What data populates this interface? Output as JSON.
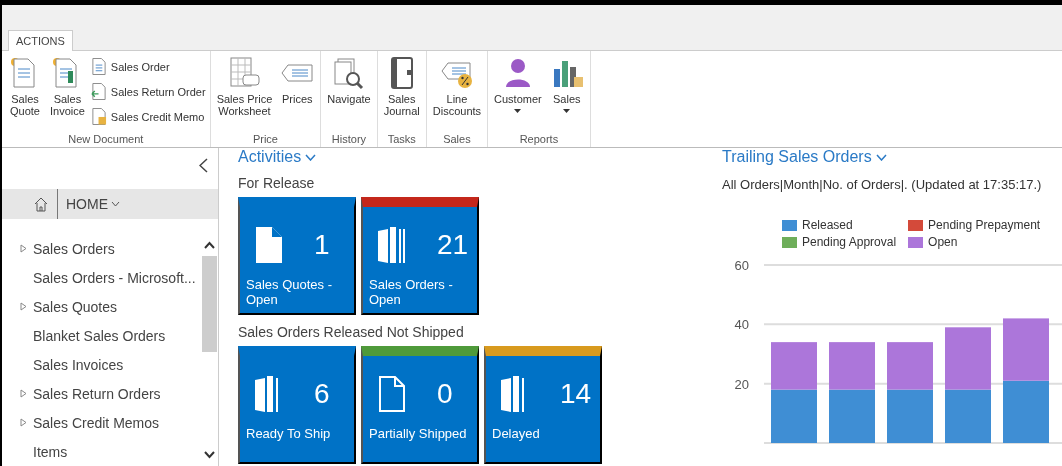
{
  "ribbon": {
    "tabs": [
      {
        "label": "ACTIONS",
        "selected": true
      }
    ],
    "groups": [
      {
        "label": "New Document",
        "items": [
          {
            "kind": "large",
            "label": "Sales\nQuote"
          },
          {
            "kind": "large",
            "label": "Sales\nInvoice"
          },
          {
            "kind": "small",
            "label": "Sales Order"
          },
          {
            "kind": "small",
            "label": "Sales Return Order"
          },
          {
            "kind": "small",
            "label": "Sales Credit Memo"
          }
        ]
      },
      {
        "label": "Price",
        "items": [
          {
            "kind": "large",
            "label": "Sales Price\nWorksheet"
          },
          {
            "kind": "large",
            "label": "Prices"
          }
        ]
      },
      {
        "label": "History",
        "items": [
          {
            "kind": "large",
            "label": "Navigate"
          }
        ]
      },
      {
        "label": "Tasks",
        "items": [
          {
            "kind": "large",
            "label": "Sales\nJournal"
          }
        ]
      },
      {
        "label": "Sales",
        "items": [
          {
            "kind": "large",
            "label": "Line\nDiscounts"
          }
        ]
      },
      {
        "label": "Reports",
        "items": [
          {
            "kind": "menu",
            "label": "Customer"
          },
          {
            "kind": "menu",
            "label": "Sales"
          }
        ]
      }
    ]
  },
  "sidebar": {
    "home": "HOME",
    "items": [
      {
        "kind": "group",
        "label": "Sales Orders"
      },
      {
        "kind": "link",
        "label": "Sales Orders - Microsoft..."
      },
      {
        "kind": "group",
        "label": "Sales Quotes"
      },
      {
        "kind": "link",
        "label": "Blanket Sales Orders"
      },
      {
        "kind": "link",
        "label": "Sales Invoices"
      },
      {
        "kind": "group",
        "label": "Sales Return Orders"
      },
      {
        "kind": "group",
        "label": "Sales Credit Memos"
      },
      {
        "kind": "link",
        "label": "Items"
      }
    ]
  },
  "activities": {
    "title": "Activities",
    "sections": [
      {
        "title": "For Release",
        "tiles": [
          {
            "count": "1",
            "label": "Sales Quotes - Open"
          },
          {
            "count": "21",
            "label": "Sales Orders - Open",
            "color": "#c4271b"
          }
        ]
      },
      {
        "title": "Sales Orders Released Not Shipped",
        "tiles": [
          {
            "count": "6",
            "label": "Ready To Ship"
          },
          {
            "count": "0",
            "label": "Partially Shipped",
            "color": "#4f9a3a"
          },
          {
            "count": "14",
            "label": "Delayed",
            "color": "#d89a1e"
          }
        ]
      }
    ]
  },
  "trailing": {
    "title": "Trailing Sales Orders",
    "subtitle": "All Orders|Month|No. of Orders|. (Updated at 17:35:17.)",
    "chart_data": {
      "type": "bar",
      "stacked": true,
      "grid": true,
      "ylim": [
        0,
        60
      ],
      "yticks": [
        20,
        40,
        60
      ],
      "series": [
        {
          "name": "Released",
          "color": "#3f8ed4",
          "values": [
            18,
            18,
            18,
            18,
            21
          ]
        },
        {
          "name": "Pending Prepayment",
          "color": "#d44a3a",
          "values": [
            0,
            0,
            0,
            0,
            0
          ]
        },
        {
          "name": "Pending Approval",
          "color": "#6eae5a",
          "values": [
            0,
            0,
            0,
            0,
            0
          ]
        },
        {
          "name": "Open",
          "color": "#ac76da",
          "values": [
            16,
            16,
            16,
            21,
            21
          ]
        }
      ]
    }
  }
}
